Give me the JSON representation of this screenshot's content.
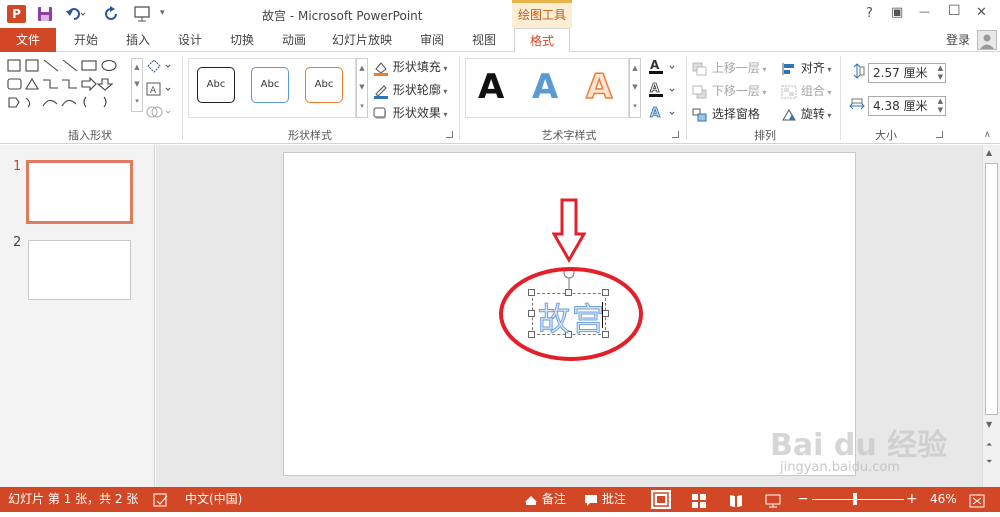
{
  "window": {
    "title": "故宫 - Microsoft PowerPoint",
    "contextual_tab_group": "绘图工具",
    "app_icon_letter": "P",
    "controls": {
      "help": "?",
      "restore_ribbon": "▣",
      "minimize": "—",
      "maximize": "☐",
      "close": "✕"
    }
  },
  "tabs": [
    {
      "label": "文件"
    },
    {
      "label": "开始"
    },
    {
      "label": "插入"
    },
    {
      "label": "设计"
    },
    {
      "label": "切换"
    },
    {
      "label": "动画"
    },
    {
      "label": "幻灯片放映"
    },
    {
      "label": "审阅"
    },
    {
      "label": "视图"
    },
    {
      "label": "格式"
    }
  ],
  "account": {
    "signin": "登录"
  },
  "ribbon": {
    "insert_shapes": {
      "label": "插入形状"
    },
    "shape_styles": {
      "label": "形状样式",
      "samples": [
        "Abc",
        "Abc",
        "Abc"
      ],
      "fill": "形状填充",
      "outline": "形状轮廓",
      "effects": "形状效果"
    },
    "wordart_styles": {
      "label": "艺术字样式",
      "letters": [
        "A",
        "A",
        "A"
      ]
    },
    "arrange": {
      "label": "排列",
      "bring_forward": "上移一层",
      "send_backward": "下移一层",
      "selection_pane": "选择窗格",
      "align": "对齐",
      "group": "组合",
      "rotate": "旋转"
    },
    "size": {
      "label": "大小",
      "height": "2.57 厘米",
      "width": "4.38 厘米"
    }
  },
  "thumbnails": [
    {
      "number": "1",
      "selected": true
    },
    {
      "number": "2",
      "selected": false
    }
  ],
  "slide": {
    "textbox_text": "故宫"
  },
  "status": {
    "slide_info": "幻灯片 第 1 张，共 2 张",
    "language": "中文(中国)",
    "notes": "备注",
    "comments": "批注",
    "zoom": "46%",
    "zoom_minus": "−",
    "zoom_plus": "+"
  },
  "watermark": {
    "brand": "Bai du 经验",
    "url": "jingyan.baidu.com"
  },
  "colors": {
    "accent": "#d24726",
    "contextual": "#e8b34a",
    "annotation_red": "#e3202a",
    "wordart_blue": "#6f9fd8"
  }
}
